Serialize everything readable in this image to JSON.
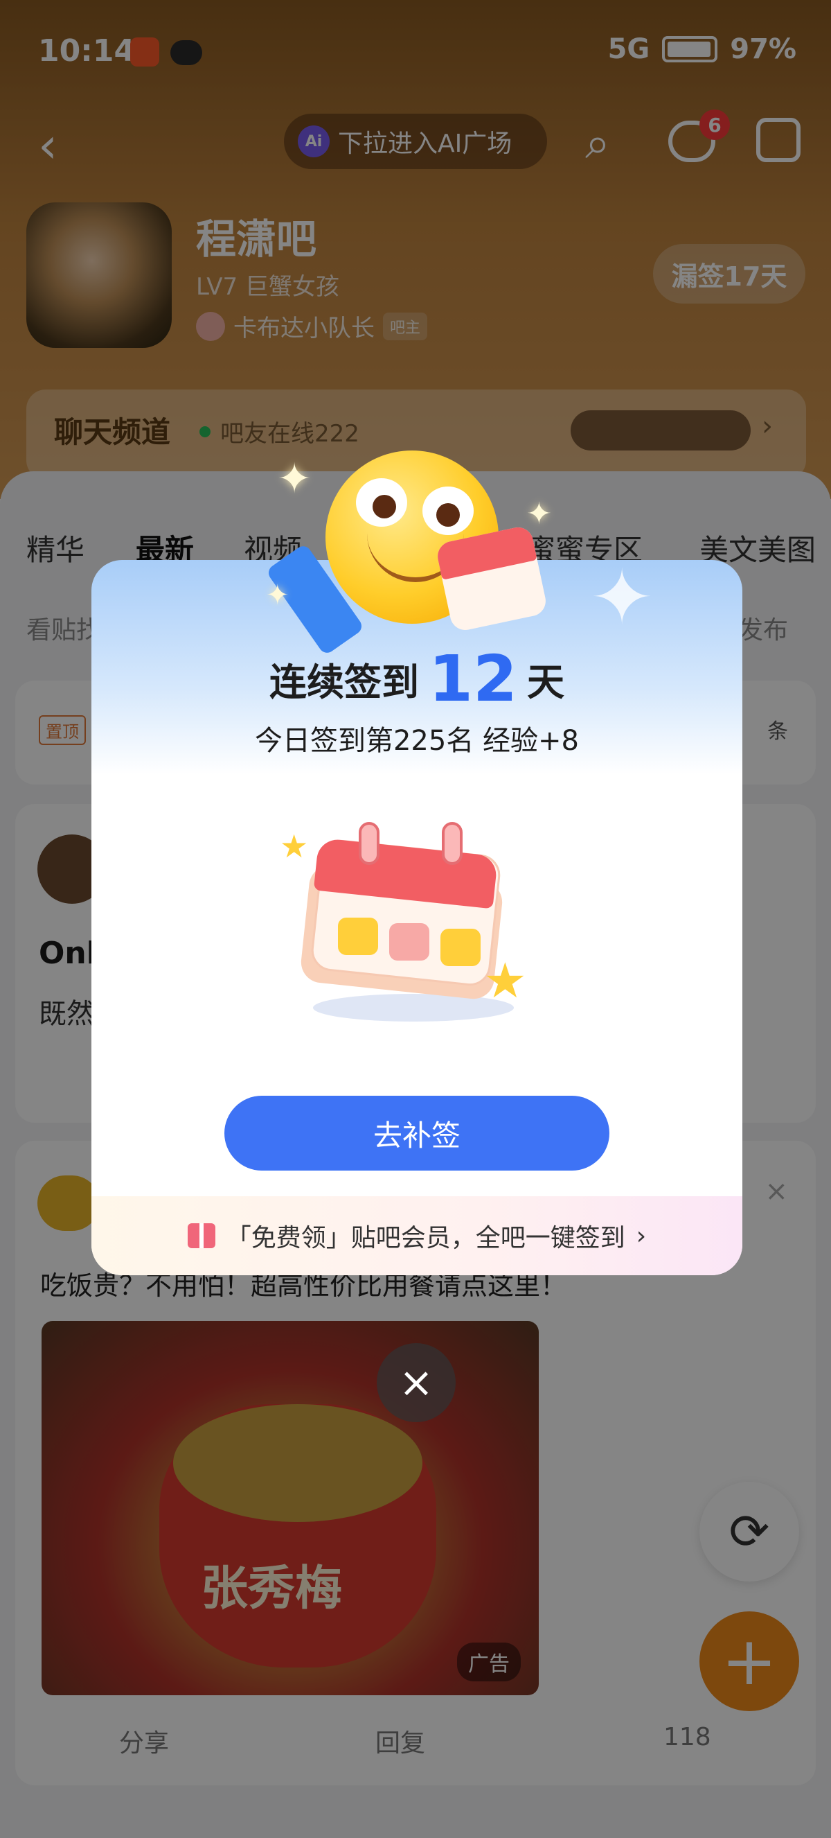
{
  "status_bar": {
    "time": "10:14",
    "network": "5G",
    "battery": "97%"
  },
  "nav": {
    "ai_entry": "下拉进入AI广场",
    "ai_badge": "Ai",
    "message_count": "6"
  },
  "forum": {
    "name": "程潇吧",
    "level": "LV7 巨蟹女孩",
    "owner_name": "卡布达小队长",
    "owner_tag": "吧主",
    "missed_signin": "漏签17天"
  },
  "chat": {
    "title": "聊天频道",
    "online": "吧友在线222"
  },
  "tabs": [
    "精华",
    "最新",
    "视频",
    "蜜蜜专区",
    "美文美图"
  ],
  "subtabs": {
    "left": "看贴找",
    "right": "发布"
  },
  "pinned_card": {
    "tag": "置顶",
    "sort": "条"
  },
  "post": {
    "title": "Onl",
    "text": "既然"
  },
  "ad": {
    "text": "吃饭贵？不用怕！超高性价比用餐请点这里！",
    "brand": "张秀梅",
    "tag": "广告",
    "share": "分享",
    "reply": "回复",
    "likes": "118"
  },
  "dialog": {
    "title_prefix": "连续签到",
    "days": "12",
    "title_suffix": "天",
    "subtitle": "今日签到第225名 经验+8",
    "button": "去补签",
    "footer": "「免费领」贴吧会员，全吧一键签到",
    "footer_arrow": "›"
  },
  "icons": {
    "close": "×",
    "back": "‹",
    "search": "⌕",
    "refresh": "⟳",
    "add": "+"
  },
  "colors": {
    "accent_blue": "#3e73f5",
    "fab_orange": "#f08a1a",
    "badge_red": "#ff3b3b"
  }
}
